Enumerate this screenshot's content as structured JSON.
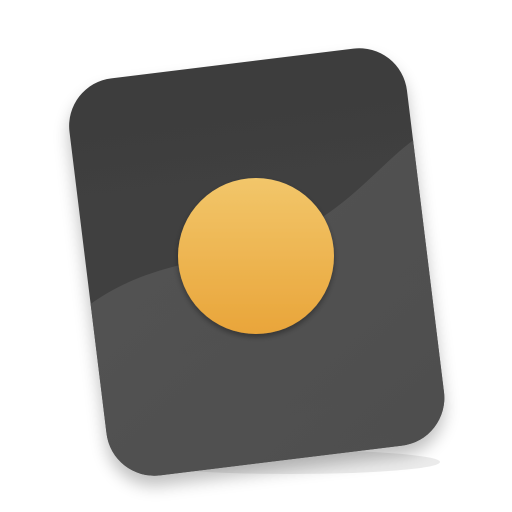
{
  "icon": {
    "name": "app-icon",
    "colors": {
      "card_dark": "#3d3d3d",
      "card_light": "#565656",
      "card_wave": "#4e4e4e",
      "dot_top": "#f2c66a",
      "dot_bottom": "#e9a53a",
      "shadow": "#000000"
    }
  }
}
